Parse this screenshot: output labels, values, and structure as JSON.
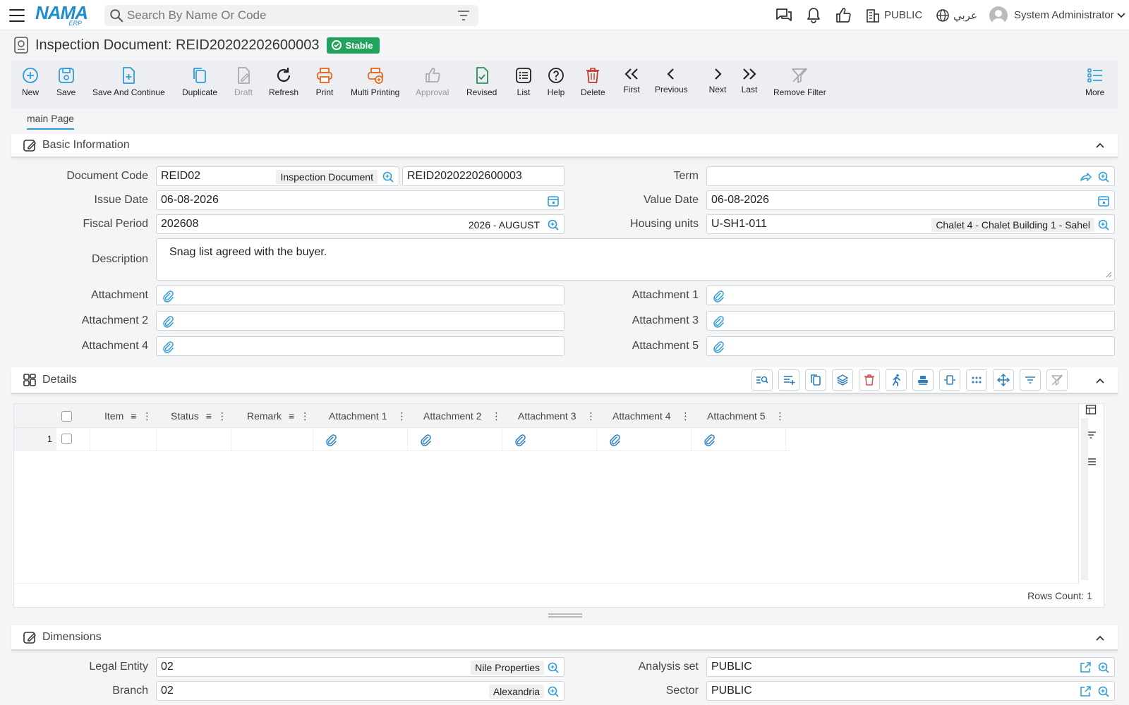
{
  "topbar": {
    "search_placeholder": "Search By Name Or Code",
    "company": "PUBLIC",
    "language": "عربي",
    "user": "System Administrator"
  },
  "logo": {
    "name": "NAMA",
    "sub": "ERP"
  },
  "title": {
    "text": "Inspection Document: REID20202202600003",
    "status": "Stable"
  },
  "toolbar": {
    "new": "New",
    "save": "Save",
    "save_continue": "Save And Continue",
    "duplicate": "Duplicate",
    "draft": "Draft",
    "refresh": "Refresh",
    "print": "Print",
    "multi_printing": "Multi Printing",
    "approval": "Approval",
    "revised": "Revised",
    "list": "List",
    "help": "Help",
    "delete": "Delete",
    "first": "First",
    "previous": "Previous",
    "next": "Next",
    "last": "Last",
    "remove_filter": "Remove Filter",
    "more": "More"
  },
  "tabs": {
    "main": "main Page"
  },
  "basic": {
    "title": "Basic Information",
    "document_code_label": "Document Code",
    "document_code": "REID02",
    "document_type": "Inspection Document",
    "document_number": "REID20202202600003",
    "term_label": "Term",
    "issue_date_label": "Issue Date",
    "issue_date": "06-08-2026",
    "value_date_label": "Value Date",
    "value_date": "06-08-2026",
    "fiscal_period_label": "Fiscal Period",
    "fiscal_period": "202608",
    "fiscal_period_name": "2026 - AUGUST",
    "housing_units_label": "Housing units",
    "housing_unit": "U-SH1-011",
    "housing_unit_name": "Chalet 4 - Chalet Building 1 - Sahel",
    "description_label": "Description",
    "description": "Snag list agreed with the buyer.",
    "attachment_label": "Attachment",
    "attachment1_label": "Attachment 1",
    "attachment2_label": "Attachment 2",
    "attachment3_label": "Attachment 3",
    "attachment4_label": "Attachment 4",
    "attachment5_label": "Attachment 5"
  },
  "details": {
    "title": "Details",
    "columns": [
      "Item",
      "Status",
      "Remark",
      "Attachment 1",
      "Attachment 2",
      "Attachment 3",
      "Attachment 4",
      "Attachment 5"
    ],
    "rows": [
      {
        "num": "1"
      }
    ],
    "rows_count": "Rows Count: 1"
  },
  "dimensions": {
    "title": "Dimensions",
    "legal_entity_label": "Legal Entity",
    "legal_entity": "02",
    "legal_entity_name": "Nile Properties",
    "analysis_set_label": "Analysis set",
    "analysis_set": "PUBLIC",
    "branch_label": "Branch",
    "branch": "02",
    "branch_name": "Alexandria",
    "sector_label": "Sector",
    "sector": "PUBLIC"
  },
  "colors": {
    "accent": "#2f9bd6",
    "status": "#21a35b",
    "orange": "#e8641b",
    "red": "#c0392b",
    "green": "#2e8b57"
  }
}
